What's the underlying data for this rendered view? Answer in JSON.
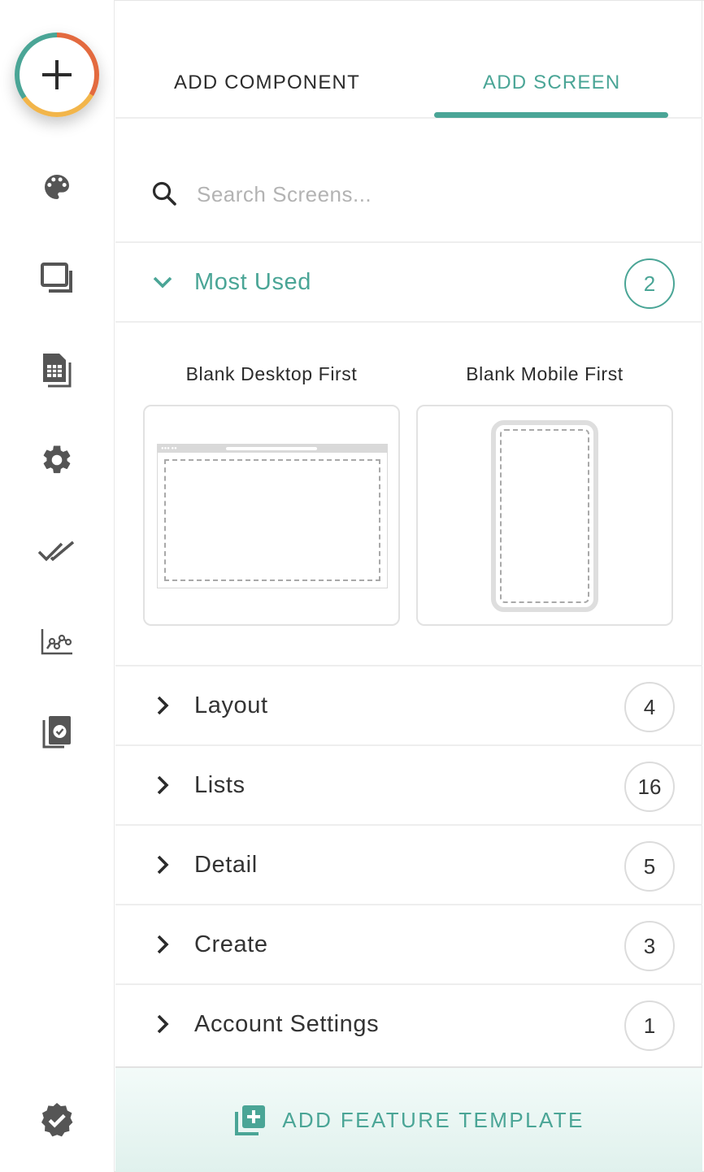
{
  "tabs": {
    "add_component": "ADD COMPONENT",
    "add_screen": "ADD SCREEN",
    "active": "add_screen"
  },
  "search": {
    "placeholder": "Search Screens...",
    "value": ""
  },
  "sections": [
    {
      "label": "Most Used",
      "count": "2",
      "expanded": true
    },
    {
      "label": "Layout",
      "count": "4",
      "expanded": false
    },
    {
      "label": "Lists",
      "count": "16",
      "expanded": false
    },
    {
      "label": "Detail",
      "count": "5",
      "expanded": false
    },
    {
      "label": "Create",
      "count": "3",
      "expanded": false
    },
    {
      "label": "Account Settings",
      "count": "1",
      "expanded": false
    }
  ],
  "templates": [
    {
      "title": "Blank Desktop First",
      "preview": "desktop-wireframe"
    },
    {
      "title": "Blank Mobile First",
      "preview": "mobile-wireframe"
    }
  ],
  "footer": {
    "label": "ADD FEATURE TEMPLATE",
    "icon": "add-template-icon"
  },
  "rail": {
    "icons": [
      "add-icon",
      "palette-icon",
      "screens-icon",
      "data-table-icon",
      "settings-icon",
      "double-check-icon",
      "analytics-icon",
      "app-review-icon",
      "verified-icon"
    ]
  },
  "colors": {
    "accent": "#4aa596",
    "ring_orange": "#e36a3f",
    "ring_yellow": "#f2b54a",
    "icon_gray": "#555555"
  }
}
